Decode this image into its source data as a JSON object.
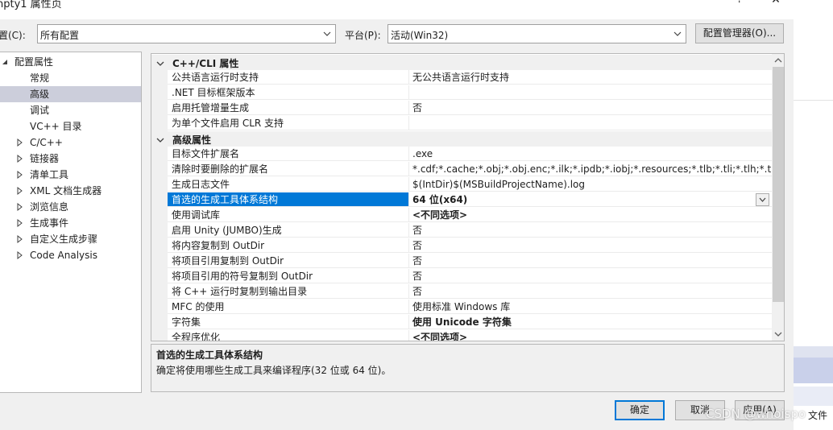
{
  "title": "npty1 属性页",
  "window_controls": {
    "help": "?",
    "close": "✕"
  },
  "config": {
    "label": "置(C):",
    "value": "所有配置"
  },
  "platform": {
    "label": "平台(P):",
    "value": "活动(Win32)"
  },
  "config_manager_label": "配置管理器(O)...",
  "tree": {
    "root": "配置属性",
    "items": [
      {
        "label": "常规",
        "expandable": false,
        "selected": false
      },
      {
        "label": "高级",
        "expandable": false,
        "selected": true
      },
      {
        "label": "调试",
        "expandable": false,
        "selected": false
      },
      {
        "label": "VC++ 目录",
        "expandable": false,
        "selected": false
      },
      {
        "label": "C/C++",
        "expandable": true,
        "selected": false
      },
      {
        "label": "链接器",
        "expandable": true,
        "selected": false
      },
      {
        "label": "清单工具",
        "expandable": true,
        "selected": false
      },
      {
        "label": "XML 文档生成器",
        "expandable": true,
        "selected": false
      },
      {
        "label": "浏览信息",
        "expandable": true,
        "selected": false
      },
      {
        "label": "生成事件",
        "expandable": true,
        "selected": false
      },
      {
        "label": "自定义生成步骤",
        "expandable": true,
        "selected": false
      },
      {
        "label": "Code Analysis",
        "expandable": true,
        "selected": false
      }
    ]
  },
  "grid": {
    "categories": [
      {
        "label": "C++/CLI 属性",
        "rows": [
          {
            "name": "公共语言运行时支持",
            "value": "无公共语言运行时支持"
          },
          {
            "name": ".NET 目标框架版本",
            "value": ""
          },
          {
            "name": "启用托管增量生成",
            "value": "否"
          },
          {
            "name": "为单个文件启用 CLR 支持",
            "value": ""
          }
        ]
      },
      {
        "label": "高级属性",
        "rows": [
          {
            "name": "目标文件扩展名",
            "value": ".exe"
          },
          {
            "name": "清除时要删除的扩展名",
            "value": "*.cdf;*.cache;*.obj;*.obj.enc;*.ilk;*.ipdb;*.iobj;*.resources;*.tlb;*.tli;*.tlh;*.tmp;*.rs"
          },
          {
            "name": "生成日志文件",
            "value": "$(IntDir)$(MSBuildProjectName).log"
          },
          {
            "name": "首选的生成工具体系结构",
            "value": "64 位(x64)",
            "bold": true,
            "selected": true
          },
          {
            "name": "使用调试库",
            "value": "<不同选项>",
            "bold": true
          },
          {
            "name": "启用 Unity (JUMBO)生成",
            "value": "否"
          },
          {
            "name": "将内容复制到 OutDir",
            "value": "否"
          },
          {
            "name": "将项目引用复制到 OutDir",
            "value": "否"
          },
          {
            "name": "将项目引用的符号复制到 OutDir",
            "value": "否"
          },
          {
            "name": "将 C++ 运行时复制到输出目录",
            "value": "否"
          },
          {
            "name": "MFC 的使用",
            "value": "使用标准 Windows 库"
          },
          {
            "name": "字符集",
            "value": "使用 Unicode 字符集",
            "bold": true
          },
          {
            "name": "全程序优化",
            "value": "<不同选项>",
            "bold": true
          }
        ]
      }
    ]
  },
  "description": {
    "title": "首选的生成工具体系结构",
    "text": "确定将使用哪些生成工具来编译程序(32 位或 64 位)。"
  },
  "buttons": {
    "ok": "确定",
    "cancel": "取消",
    "apply": "应用(A)"
  },
  "background_window": {
    "tab_label": "文件"
  },
  "watermark": "CSDN @whoispo",
  "colors": {
    "selection": "#0078d7",
    "tree_selection": "#cccedb",
    "dialog_bg": "#f0f0f0"
  }
}
